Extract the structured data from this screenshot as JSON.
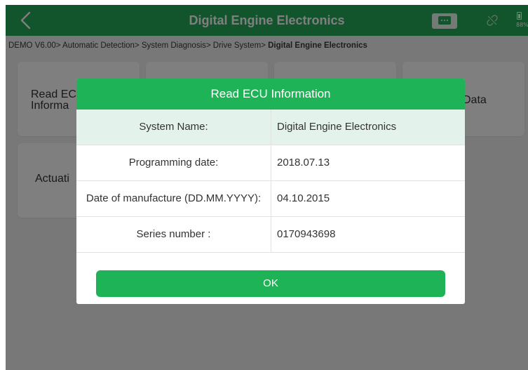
{
  "header": {
    "title": "Digital Engine Electronics",
    "back_icon": "chevron-left-icon",
    "chat_icon": "chat-bubble-icon",
    "link_icon": "unlinked-icon",
    "battery_icon": "battery-icon",
    "battery_percent": "88%"
  },
  "breadcrumb": {
    "path": "DEMO V6.00> Automatic Detection> System Diagnosis> Drive System> ",
    "current": "Digital Engine Electronics"
  },
  "tiles": [
    {
      "label": "Read EC",
      "label_line2": "Informa"
    },
    {
      "label": ""
    },
    {
      "label": ""
    },
    {
      "label": "Data"
    },
    {
      "label": "Actuati"
    }
  ],
  "dialog": {
    "title": "Read ECU Information",
    "rows": [
      {
        "label": "System Name:",
        "value": "Digital Engine Electronics"
      },
      {
        "label": "Programming date:",
        "value": "2018.07.13"
      },
      {
        "label": "Date of manufacture (DD.MM.YYYY):",
        "value": "04.10.2015"
      },
      {
        "label": "Series number :",
        "value": "0170943698"
      }
    ],
    "ok_label": "OK"
  },
  "colors": {
    "accent": "#24a857",
    "dialog_green": "#1fb357",
    "row_shade": "#e4f2ec"
  }
}
